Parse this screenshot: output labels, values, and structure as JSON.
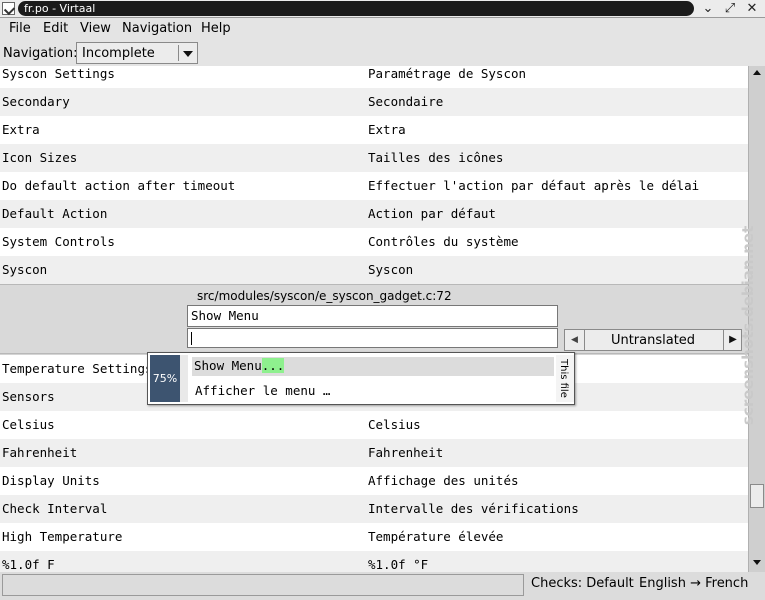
{
  "window": {
    "title": "fr.po - Virtaal",
    "controls": [
      "chevron-down-icon",
      "maximize-icon",
      "close-icon"
    ]
  },
  "menu": {
    "file": "File",
    "edit": "Edit",
    "view": "View",
    "navigation": "Navigation",
    "help": "Help"
  },
  "navbar": {
    "label": "Navigation:",
    "selected": "Incomplete"
  },
  "rows_top": [
    {
      "source": "Syscon Settings",
      "target": "Paramétrage de Syscon"
    },
    {
      "source": "Secondary",
      "target": "Secondaire"
    },
    {
      "source": "Extra",
      "target": "Extra"
    },
    {
      "source": "Icon Sizes",
      "target": "Tailles des icônes"
    },
    {
      "source": "Do default action after timeout",
      "target": "Effectuer l'action par défaut après le délai"
    },
    {
      "source": "Default Action",
      "target": "Action par défaut"
    },
    {
      "source": "System Controls",
      "target": "Contrôles du système"
    },
    {
      "source": "Syscon",
      "target": "Syscon"
    }
  ],
  "editor": {
    "location": "src/modules/syscon/e_syscon_gadget.c:72",
    "source_text": "Show Menu",
    "target_text": "",
    "status": "Untranslated"
  },
  "suggestion": {
    "match_percent": "75%",
    "source_prefix": "Show Menu",
    "source_highlight": "...",
    "target": "Afficher le menu …",
    "origin": "This file"
  },
  "rows_bottom": [
    {
      "source": "Temperature Settings",
      "target": ""
    },
    {
      "source": "Sensors",
      "target": ""
    },
    {
      "source": "Celsius",
      "target": "Celsius"
    },
    {
      "source": "Fahrenheit",
      "target": "Fahrenheit"
    },
    {
      "source": "Display Units",
      "target": "Affichage des unités"
    },
    {
      "source": "Check Interval",
      "target": "Intervalle des vérifications"
    },
    {
      "source": "High Temperature",
      "target": "Température élevée"
    },
    {
      "source": "%1.0f F",
      "target": "%1.0f °F"
    }
  ],
  "statusbar": {
    "checks": "Checks: Default",
    "languages": "English → French"
  },
  "watermark": "screenshots.debian.net"
}
